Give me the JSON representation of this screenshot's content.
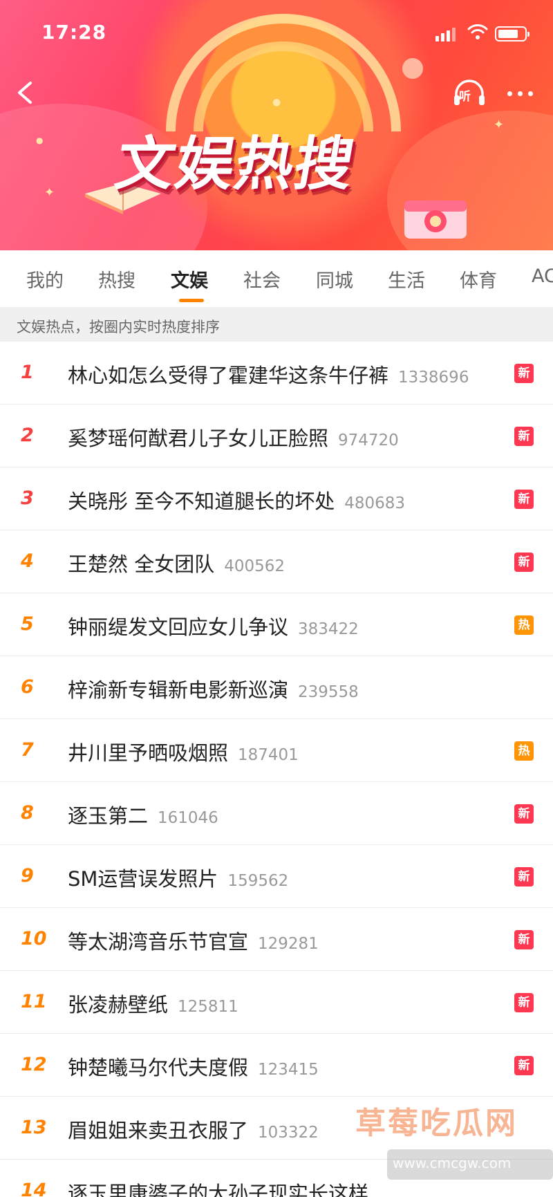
{
  "status_bar": {
    "time": "17:28"
  },
  "header": {
    "title": "文娱热搜",
    "listen_label": "听"
  },
  "tabs": [
    {
      "label": "我的"
    },
    {
      "label": "热搜"
    },
    {
      "label": "文娱",
      "active": true
    },
    {
      "label": "社会"
    },
    {
      "label": "同城"
    },
    {
      "label": "生活"
    },
    {
      "label": "体育"
    },
    {
      "label": "AC"
    }
  ],
  "subhead": "文娱热点，按圈内实时热度排序",
  "list": [
    {
      "rank": "1",
      "title": "林心如怎么受得了霍建华这条牛仔裤",
      "count": "1338696",
      "badge": "新",
      "badge_type": "new"
    },
    {
      "rank": "2",
      "title": "奚梦瑶何猷君儿子女儿正脸照",
      "count": "974720",
      "badge": "新",
      "badge_type": "new"
    },
    {
      "rank": "3",
      "title": "关晓彤 至今不知道腿长的坏处",
      "count": "480683",
      "badge": "新",
      "badge_type": "new"
    },
    {
      "rank": "4",
      "title": "王楚然 全女团队",
      "count": "400562",
      "badge": "新",
      "badge_type": "new"
    },
    {
      "rank": "5",
      "title": "钟丽缇发文回应女儿争议",
      "count": "383422",
      "badge": "热",
      "badge_type": "hot"
    },
    {
      "rank": "6",
      "title": "梓渝新专辑新电影新巡演",
      "count": "239558",
      "badge": "",
      "badge_type": ""
    },
    {
      "rank": "7",
      "title": "井川里予晒吸烟照",
      "count": "187401",
      "badge": "热",
      "badge_type": "hot"
    },
    {
      "rank": "8",
      "title": "逐玉第二",
      "count": "161046",
      "badge": "新",
      "badge_type": "new"
    },
    {
      "rank": "9",
      "title": "SM运营误发照片",
      "count": "159562",
      "badge": "新",
      "badge_type": "new"
    },
    {
      "rank": "10",
      "title": "等太湖湾音乐节官宣",
      "count": "129281",
      "badge": "新",
      "badge_type": "new"
    },
    {
      "rank": "11",
      "title": "张凌赫壁纸",
      "count": "125811",
      "badge": "新",
      "badge_type": "new"
    },
    {
      "rank": "12",
      "title": "钟楚曦马尔代夫度假",
      "count": "123415",
      "badge": "新",
      "badge_type": "new"
    },
    {
      "rank": "13",
      "title": "眉姐姐来卖丑衣服了",
      "count": "103322",
      "badge": "",
      "badge_type": ""
    },
    {
      "rank": "14",
      "title": "逐玉里康婆子的大孙子现实长这样",
      "count": "",
      "badge": "",
      "badge_type": ""
    }
  ],
  "watermark": {
    "text": "草莓吃瓜网",
    "sub": "www.cmcgw.com"
  },
  "colors": {
    "accent": "#ff8200",
    "rank_top": "#f5403f",
    "badge_new": "#ff3852",
    "badge_hot": "#ff9406"
  }
}
